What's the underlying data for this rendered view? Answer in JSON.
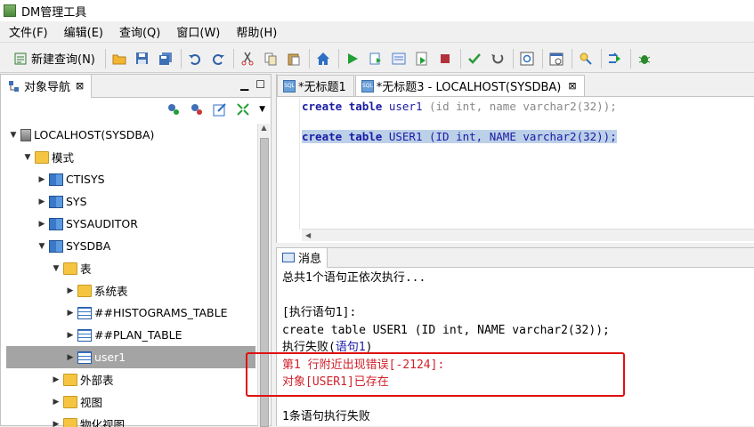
{
  "window": {
    "title": "DM管理工具"
  },
  "menubar": [
    "文件(F)",
    "编辑(E)",
    "查询(Q)",
    "窗口(W)",
    "帮助(H)"
  ],
  "toolbar": {
    "new_query_label": "新建查询(N)"
  },
  "navigator": {
    "tab_label": "对象导航",
    "close_glyph": "⊠",
    "tree": [
      {
        "label": "LOCALHOST(SYSDBA)",
        "level": 0,
        "expanded": true,
        "icon": "db-icon"
      },
      {
        "label": "模式",
        "level": 1,
        "expanded": true,
        "icon": "folder-icon"
      },
      {
        "label": "CTISYS",
        "level": 2,
        "expanded": false,
        "icon": "schema-icon"
      },
      {
        "label": "SYS",
        "level": 2,
        "expanded": false,
        "icon": "schema-icon"
      },
      {
        "label": "SYSAUDITOR",
        "level": 2,
        "expanded": false,
        "icon": "schema-icon"
      },
      {
        "label": "SYSDBA",
        "level": 2,
        "expanded": true,
        "icon": "schema-icon"
      },
      {
        "label": "表",
        "level": 3,
        "expanded": true,
        "icon": "folder-icon"
      },
      {
        "label": "系统表",
        "level": 4,
        "expanded": false,
        "icon": "folder-icon"
      },
      {
        "label": "##HISTOGRAMS_TABLE",
        "level": 4,
        "expanded": false,
        "icon": "table-icon"
      },
      {
        "label": "##PLAN_TABLE",
        "level": 4,
        "expanded": false,
        "icon": "table-icon"
      },
      {
        "label": "user1",
        "level": 4,
        "expanded": false,
        "icon": "table-icon",
        "selected": true
      },
      {
        "label": "外部表",
        "level": 3,
        "expanded": false,
        "icon": "folder-icon"
      },
      {
        "label": "视图",
        "level": 3,
        "expanded": false,
        "icon": "folder-icon"
      },
      {
        "label": "物化视图",
        "level": 3,
        "expanded": false,
        "icon": "folder-icon"
      }
    ]
  },
  "editor": {
    "tabs": [
      {
        "label": "*无标题1",
        "active": false
      },
      {
        "label": "*无标题3 - LOCALHOST(SYSDBA)",
        "active": true
      }
    ],
    "lines": {
      "l1_kw1": "create",
      "l1_kw2": "table",
      "l1_name": "user1",
      "l1_rest": " (id int, name varchar2(32));",
      "l2_kw1": "create",
      "l2_kw2": "table",
      "l2_rest": " USER1 (ID int, NAME varchar2(32));"
    }
  },
  "messages": {
    "tab_label": "消息",
    "lines": [
      {
        "text": "总共1个语句正依次执行...",
        "style": "normal"
      },
      {
        "text": "",
        "style": "normal"
      },
      {
        "text": "[执行语句1]:",
        "style": "normal"
      },
      {
        "text": "create table USER1 (ID int, NAME varchar2(32));",
        "style": "normal"
      },
      {
        "text": "执行失败(",
        "style": "normal",
        "link": "语句1",
        "after": ")"
      },
      {
        "text": "第1 行附近出现错误[-2124]:",
        "style": "error"
      },
      {
        "text": "对象[USER1]已存在",
        "style": "error"
      },
      {
        "text": "",
        "style": "normal"
      },
      {
        "text": "1条语句执行失败",
        "style": "normal"
      }
    ]
  },
  "colors": {
    "error": "#d0212b",
    "keyword": "#1a1aa6",
    "annotation_box": "#e01010",
    "selection": "#a4a4a4"
  }
}
